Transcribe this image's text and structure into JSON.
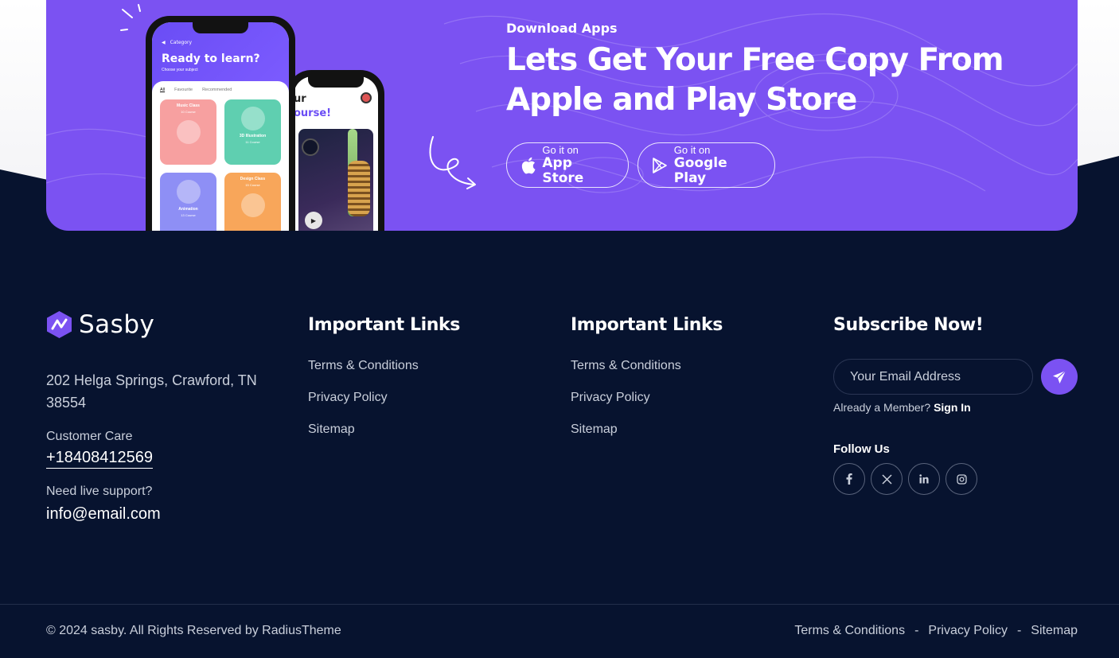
{
  "banner": {
    "eyebrow": "Download Apps",
    "title_line1": "Lets Get Your Free Copy From",
    "title_line2": "Apple and Play Store",
    "app_store": {
      "small": "Go it on",
      "big": "App Store"
    },
    "google_play": {
      "small": "Go it on",
      "big": "Google Play"
    },
    "phone_left": {
      "category": "Category",
      "title": "Ready to learn?",
      "subtitle": "Choose your subject",
      "tabs": [
        "All",
        "Favourite",
        "Recommended"
      ],
      "cards": [
        {
          "title": "Music Class",
          "count": "10 Course"
        },
        {
          "title": "3D Illustration",
          "count": "11 Course"
        },
        {
          "title": "Animation",
          "count": "13 Course"
        },
        {
          "title": "Design Class",
          "count": "15 Course"
        }
      ]
    },
    "phone_right": {
      "line1": "ur",
      "line2": "ourse!"
    }
  },
  "footer": {
    "brand": "Sasby",
    "address": "202 Helga Springs, Crawford, TN 38554",
    "customer_care_label": "Customer Care",
    "phone": "+18408412569",
    "support_label": "Need live support?",
    "email": "info@email.com",
    "col2": {
      "title": "Important Links",
      "links": [
        "Terms & Conditions",
        "Privacy Policy",
        "Sitemap"
      ]
    },
    "col3": {
      "title": "Important Links",
      "links": [
        "Terms & Conditions",
        "Privacy Policy",
        "Sitemap"
      ]
    },
    "subscribe": {
      "title": "Subscribe Now!",
      "placeholder": "Your Email Address",
      "member_text": "Already a Member?",
      "signin": "Sign In",
      "follow_title": "Follow Us",
      "socials": [
        "facebook-icon",
        "x-icon",
        "linkedin-icon",
        "instagram-icon"
      ]
    },
    "copyright": "© 2024 sasby. All Rights Reserved by RadiusTheme",
    "bottom_links": [
      "Terms & Conditions",
      "Privacy Policy",
      "Sitemap"
    ],
    "separator": "-"
  },
  "colors": {
    "brand_purple": "#7b52f2",
    "footer_bg": "#07132f"
  }
}
